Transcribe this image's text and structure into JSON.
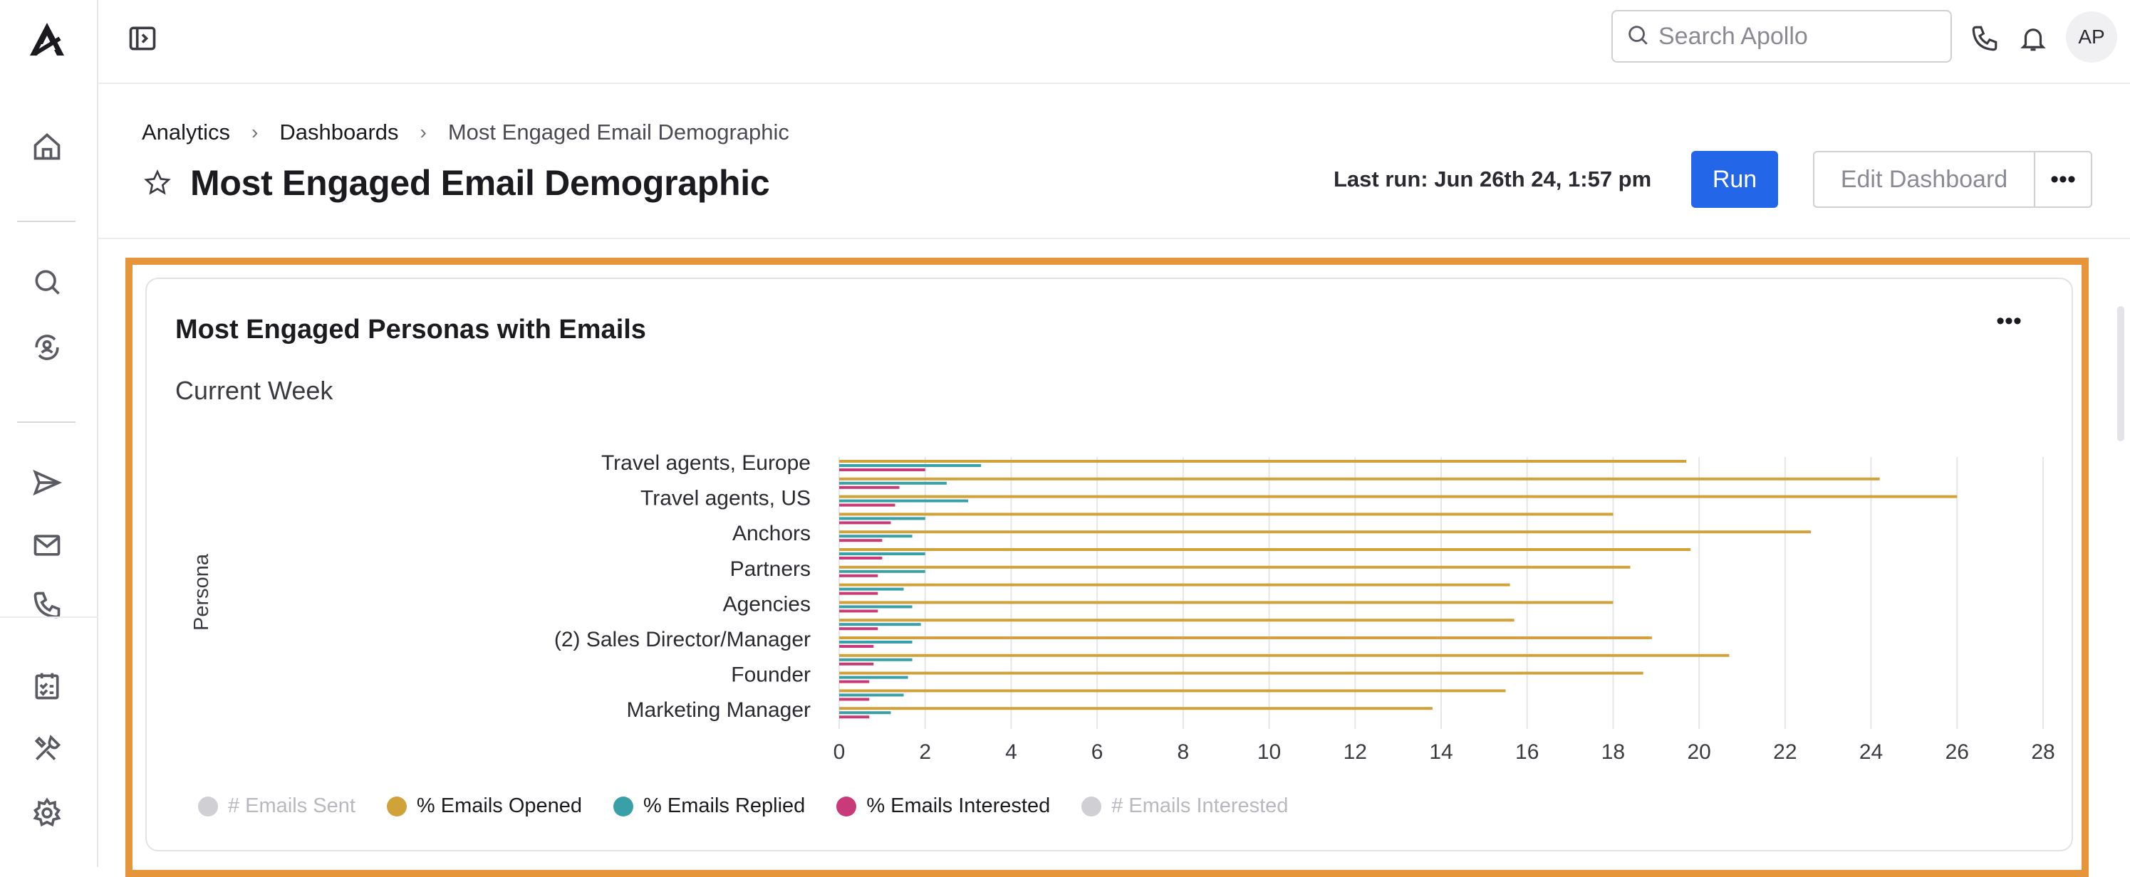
{
  "rail": {
    "icons": [
      "logo-icon",
      "home-icon",
      "search-icon",
      "sequences-icon",
      "send-icon",
      "mail-icon",
      "phone-icon",
      "tasks-icon",
      "tools-icon",
      "settings-icon"
    ]
  },
  "topbar": {
    "search_placeholder": "Search Apollo",
    "avatar_initials": "AP"
  },
  "breadcrumb": {
    "items": [
      "Analytics",
      "Dashboards"
    ],
    "current": "Most Engaged Email Demographic"
  },
  "page": {
    "title": "Most Engaged Email Demographic",
    "last_run": "Last run: Jun 26th 24, 1:57 pm",
    "run_label": "Run",
    "edit_label": "Edit Dashboard",
    "more_label": "•••"
  },
  "card": {
    "title": "Most Engaged Personas with Emails",
    "subtitle": "Current Week",
    "more_label": "•••"
  },
  "colors": {
    "accent": "#2466e8",
    "highlight": "#e6953a",
    "opened": "#d1a13a",
    "replied": "#3aa0a8",
    "interested": "#c83a78",
    "disabled": "#cfcfd4"
  },
  "chart_data": {
    "type": "bar",
    "orientation": "horizontal",
    "ylabel": "Persona",
    "xlim": [
      0,
      28
    ],
    "xticks": [
      0,
      2,
      4,
      6,
      8,
      10,
      12,
      14,
      16,
      18,
      20,
      22,
      24,
      26,
      28
    ],
    "categories": [
      "Travel agents, Europe",
      "",
      "Travel agents, US",
      "",
      "Anchors",
      "",
      "Partners",
      "",
      "Agencies",
      "",
      "(2) Sales Director/Manager",
      "",
      "Founder",
      "",
      "Marketing Manager"
    ],
    "series": [
      {
        "name": "# Emails Sent",
        "disabled": true,
        "values": []
      },
      {
        "name": "% Emails Opened",
        "values": [
          19.7,
          24.2,
          26.0,
          18.0,
          22.6,
          19.8,
          18.4,
          15.6,
          18.0,
          15.7,
          18.9,
          20.7,
          18.7,
          15.5,
          13.8
        ]
      },
      {
        "name": "% Emails Replied",
        "values": [
          3.3,
          2.5,
          3.0,
          2.0,
          1.7,
          2.0,
          2.0,
          1.5,
          1.7,
          1.9,
          1.7,
          1.7,
          1.6,
          1.5,
          1.2
        ]
      },
      {
        "name": "% Emails Interested",
        "values": [
          2.0,
          1.4,
          1.3,
          1.2,
          1.0,
          1.0,
          0.9,
          0.9,
          0.9,
          0.9,
          0.8,
          0.8,
          0.7,
          0.7,
          0.7
        ]
      },
      {
        "name": "# Emails Interested",
        "disabled": true,
        "values": []
      }
    ],
    "grid": true,
    "legend_position": "bottom-left"
  }
}
